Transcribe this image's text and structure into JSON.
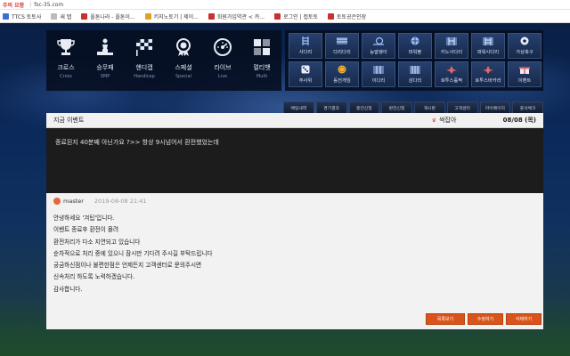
{
  "browser": {
    "warning": "주의 요함",
    "url": "fsc-35.com",
    "bookmarks": [
      {
        "label": "TTCS 토토사",
        "color": "#3b6fd8"
      },
      {
        "label": "새 탭",
        "color": "#bbbbbb"
      },
      {
        "label": "올톤나라 - 올톤이...",
        "color": "#c93030"
      },
      {
        "label": "키지노토기 | 제이...",
        "color": "#e0a020"
      },
      {
        "label": "회원가입약관 < 카...",
        "color": "#c93030"
      },
      {
        "label": "로그인 | 접토토",
        "color": "#c93030"
      },
      {
        "label": "토토공은인장",
        "color": "#c93030"
      }
    ]
  },
  "categories": [
    {
      "ko": "크로스",
      "en": "Cross",
      "icon": "trophy-icon"
    },
    {
      "ko": "승무패",
      "en": "SMP",
      "icon": "podium-icon"
    },
    {
      "ko": "핸디캡",
      "en": "Handicap",
      "icon": "racing-flag-icon"
    },
    {
      "ko": "스페셜",
      "en": "Special",
      "icon": "medal-icon"
    },
    {
      "ko": "라이브",
      "en": "Live",
      "icon": "speedometer-icon"
    },
    {
      "ko": "멀티뱃",
      "en": "Multi",
      "icon": "multi-bet-icon"
    }
  ],
  "games": [
    {
      "label": "사다리",
      "icon": "ladder-icon"
    },
    {
      "label": "다리다리",
      "icon": "bridge-icon"
    },
    {
      "label": "능말앵이",
      "icon": "snail-icon"
    },
    {
      "label": "파워볼",
      "icon": "ball-icon"
    },
    {
      "label": "키노사다리",
      "icon": "keno-ladder-icon"
    },
    {
      "label": "파워사다리",
      "icon": "power-ladder-icon"
    },
    {
      "label": "가상축구",
      "icon": "soccer-ball-icon"
    },
    {
      "label": "주사위",
      "icon": "dice-icon"
    },
    {
      "label": "동전게임",
      "icon": "coin-icon"
    },
    {
      "label": "이다리",
      "icon": "two-bridge-icon"
    },
    {
      "label": "삼다리",
      "icon": "three-bridge-icon"
    },
    {
      "label": "로투스홀짝",
      "icon": "lotus-oddeven-icon"
    },
    {
      "label": "로투스바카라",
      "icon": "lotus-baccarat-icon"
    },
    {
      "label": "이벤트",
      "icon": "event-icon"
    }
  ],
  "subnav": [
    "배팅내역",
    "경기결과",
    "충전신청",
    "환전신청",
    "게시판",
    "고객센터",
    "마이페이지",
    "출석체크"
  ],
  "panel": {
    "title": "지금 이벤트",
    "author": "싹잡아",
    "date": "08/08 (목)",
    "body": "종료된지 40분째 아닌가요 ?>> 항상 9시넘어서 환전했었는데"
  },
  "reply": {
    "user": "master",
    "time": "2019-08-08 21:41",
    "lines": [
      "안녕하세요 '겨팁'입니다.",
      "이벤트 종료후 환전이 몰려",
      "환전처리가 다소 지연되고 있습니다",
      "순차적으로 처리 중에 있으니 잠시만 기다려 주시길 부탁드립니다",
      "궁금하신점이나 불편한점은 언제든지 고객센터로 문의주시면",
      "신속처리 하도록 노력하겠습니다.",
      "감사합니다."
    ]
  },
  "actions": {
    "list_label": "목록보기",
    "edit_label": "수정하기",
    "delete_label": "삭제하기"
  },
  "colors": {
    "accent": "#d8541a",
    "header_bg": "#0a1f45",
    "panel_body_bg": "#1c1c1c"
  }
}
